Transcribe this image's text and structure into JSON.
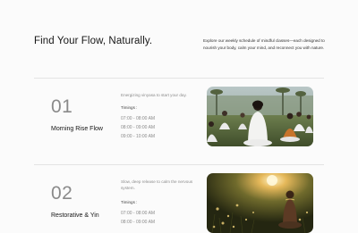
{
  "hero": {
    "title": "Find Your Flow, Naturally.",
    "description": "Explore our weekly schedule of mindful classes—each designed to nourish your body, calm your mind, and reconnect you with nature."
  },
  "classes": [
    {
      "number": "01",
      "name": "Morning Rise Flow",
      "tagline": "Energizing vinyasa to start your day.",
      "timings_label": "Timings :",
      "timings": [
        "07:00 - 08:00 AM",
        "08:00 - 09:00 AM",
        "09:00 - 10:00 AM"
      ],
      "image": "group-outdoor-meditation-photo"
    },
    {
      "number": "02",
      "name": "Restorative & Yin",
      "tagline": "Slow, deep release to calm the nervous system.",
      "timings_label": "Timings :",
      "timings": [
        "07:00 - 08:00 AM",
        "08:00 - 09:00 AM"
      ],
      "image": "sunset-meadow-meditation-photo"
    }
  ],
  "colors": {
    "background": "#fbfbfb",
    "text_primary": "#151515",
    "text_muted": "#8a8a8a",
    "divider": "#e4e4e4"
  }
}
